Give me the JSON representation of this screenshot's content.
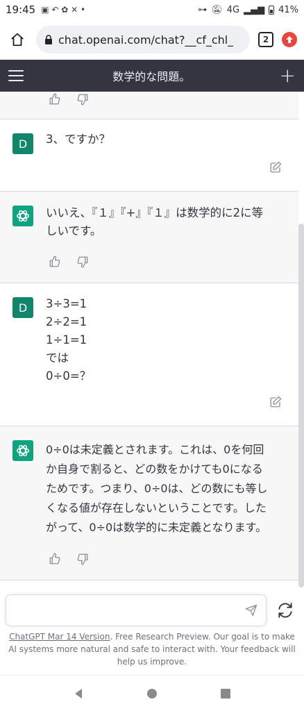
{
  "status_bar": {
    "time": "19:45",
    "network": "4G",
    "battery": "41%"
  },
  "browser": {
    "url": "chat.openai.com/chat?__cf_chl_",
    "tab_count": "2"
  },
  "header": {
    "title": "数学的な問題。"
  },
  "messages": [
    {
      "role": "user",
      "avatar": "D",
      "lines": [
        "3、ですか？"
      ]
    },
    {
      "role": "assistant",
      "lines": [
        "いいえ、『１』『+』『１』は数学的に2に等",
        "しいです。"
      ]
    },
    {
      "role": "user",
      "avatar": "D",
      "lines": [
        "3÷3=1",
        "2÷2=1",
        "1÷1=1",
        "では",
        "0÷0=？"
      ]
    },
    {
      "role": "assistant",
      "lines": [
        "0÷0は未定義とされます。これは、0を何回",
        "か自身で割ると、どの数をかけても0になる",
        "ためです。つまり、0÷0は、どの数にも等し",
        "くなる値が存在しないということです。した",
        "がって、0÷0は数学的に未定義となります。"
      ]
    }
  ],
  "composer": {
    "placeholder": ""
  },
  "footer": {
    "link": "ChatGPT Mar 14 Version",
    "text": ". Free Research Preview. Our goal is to make AI systems more natural and safe to interact with. Your feedback will help us improve."
  },
  "icons": {
    "home": "home-icon",
    "lock": "lock-icon",
    "menu": "hamburger-icon",
    "new_chat": "plus-icon",
    "thumbs_up": "thumbs-up-icon",
    "thumbs_down": "thumbs-down-icon",
    "edit": "edit-icon",
    "send": "send-icon",
    "regenerate": "refresh-icon"
  },
  "colors": {
    "header_bg": "#343541",
    "assistant_bg": "#f7f7f8",
    "user_avatar": "#12866b",
    "bot_avatar": "#10a37f",
    "update_badge": "#e8453c"
  }
}
